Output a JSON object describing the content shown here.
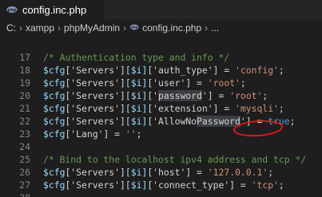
{
  "tab": {
    "filename": "config.inc.php",
    "icon": "php-file-icon"
  },
  "breadcrumb": {
    "drive": "C:",
    "folder1": "xampp",
    "folder2": "phpMyAdmin",
    "file": "config.inc.php",
    "more": "..."
  },
  "code": {
    "lines": [
      {
        "num": "17"
      },
      {
        "num": "18",
        "comment": "/* Authentication type and info */"
      },
      {
        "num": "19",
        "cfg": "$cfg",
        "a": "['Servers']",
        "i": "[$i]",
        "key": "['auth_type']",
        "eq": " = ",
        "val": "'config'",
        "end": ";"
      },
      {
        "num": "20",
        "cfg": "$cfg",
        "a": "['Servers']",
        "i": "[$i]",
        "key": "['user']",
        "eq": " = ",
        "val": "'root'",
        "end": ";"
      },
      {
        "num": "21",
        "cfg": "$cfg",
        "a": "['Servers']",
        "i": "[$i]",
        "key_pre": "['",
        "key_hl": "password",
        "key_post": "']",
        "eq": " = ",
        "val": "'root'",
        "end": ";"
      },
      {
        "num": "22",
        "cfg": "$cfg",
        "a": "['Servers']",
        "i": "[$i]",
        "key": "['extension']",
        "eq": " = ",
        "val": "'mysqli'",
        "end": ";"
      },
      {
        "num": "23",
        "cfg": "$cfg",
        "a": "['Servers']",
        "i": "[$i]",
        "key_pre": "['AllowNo",
        "key_hl": "Password",
        "key_post": "']",
        "eq": " = ",
        "kw": "true",
        "end": ";"
      },
      {
        "num": "24",
        "cfg": "$cfg",
        "key": "['Lang']",
        "eq": " = ",
        "val": "''",
        "end": ";"
      },
      {
        "num": "25"
      },
      {
        "num": "26",
        "comment": "/* Bind to the localhost ipv4 address and tcp */"
      },
      {
        "num": "27",
        "cfg": "$cfg",
        "a": "['Servers']",
        "i": "[$i]",
        "key": "['host']",
        "eq": " = ",
        "val": "'127.0.0.1'",
        "end": ";"
      },
      {
        "num": "28",
        "cfg": "$cfg",
        "a": "['Servers']",
        "i": "[$i]",
        "key": "['connect_type']",
        "eq": " = ",
        "val": "'tcp'",
        "end": ";"
      }
    ]
  },
  "colors": {
    "annotation": "#e8141c",
    "php_icon": "#8993be"
  }
}
